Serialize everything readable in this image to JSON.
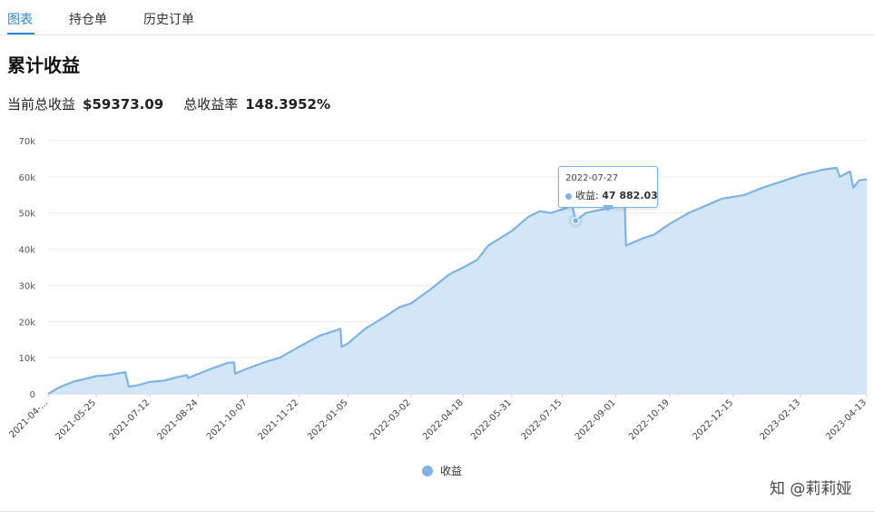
{
  "tabs": [
    {
      "label": "图表",
      "active": true
    },
    {
      "label": "持仓单",
      "active": false
    },
    {
      "label": "历史订单",
      "active": false
    }
  ],
  "title": "累计收益",
  "summary": {
    "total_profit_label": "当前总收益",
    "total_profit_value": "$59373.09",
    "total_rate_label": "总收益率",
    "total_rate_value": "148.3952%"
  },
  "tooltip": {
    "date": "2022-07-27",
    "series_label": "收益:",
    "value": "47 882.03"
  },
  "legend": {
    "label": "收益",
    "color": "#7fb2e5"
  },
  "watermark": "知 @莉莉娅",
  "chart_data": {
    "type": "area",
    "series": [
      {
        "name": "收益"
      }
    ],
    "ylim": [
      0,
      70000
    ],
    "yticks": [
      0,
      10000,
      20000,
      30000,
      40000,
      50000,
      60000,
      70000
    ],
    "ytick_labels": [
      "0",
      "10k",
      "20k",
      "30k",
      "40k",
      "50k",
      "60k",
      "70k"
    ],
    "xlim": [
      "2021-04-12",
      "2023-04-13"
    ],
    "xtick_labels": [
      "2021-04-...",
      "2021-05-25",
      "2021-07-12",
      "2021-08-24",
      "2021-10-07",
      "2021-11-22",
      "2022-01-05",
      "2022-03-02",
      "2022-04-18",
      "2022-05-31",
      "2022-07-15",
      "2022-09-01",
      "2022-10-19",
      "2022-12-15",
      "2023-02-13",
      "2023-04-13"
    ],
    "xtick_dates": [
      "2021-04-12",
      "2021-05-25",
      "2021-07-12",
      "2021-08-24",
      "2021-10-07",
      "2021-11-22",
      "2022-01-05",
      "2022-03-02",
      "2022-04-18",
      "2022-05-31",
      "2022-07-15",
      "2022-09-01",
      "2022-10-19",
      "2022-12-15",
      "2023-02-13",
      "2023-04-13"
    ],
    "grid": true,
    "legend_position": "bottom-center",
    "colors": {
      "line": "#7fb2e5",
      "fill": "#d3e6f7"
    },
    "points": [
      [
        "2021-04-12",
        0
      ],
      [
        "2021-04-22",
        1800
      ],
      [
        "2021-05-05",
        3400
      ],
      [
        "2021-05-25",
        4900
      ],
      [
        "2021-06-05",
        5200
      ],
      [
        "2021-06-20",
        6000
      ],
      [
        "2021-06-23",
        2000
      ],
      [
        "2021-06-30",
        2300
      ],
      [
        "2021-07-12",
        3300
      ],
      [
        "2021-07-25",
        3700
      ],
      [
        "2021-08-05",
        4600
      ],
      [
        "2021-08-14",
        5200
      ],
      [
        "2021-08-15",
        4400
      ],
      [
        "2021-08-24",
        5500
      ],
      [
        "2021-09-05",
        7000
      ],
      [
        "2021-09-20",
        8600
      ],
      [
        "2021-09-25",
        8700
      ],
      [
        "2021-09-26",
        5600
      ],
      [
        "2021-10-07",
        7000
      ],
      [
        "2021-10-20",
        8500
      ],
      [
        "2021-11-05",
        10000
      ],
      [
        "2021-11-22",
        13000
      ],
      [
        "2021-12-10",
        16000
      ],
      [
        "2021-12-29",
        18000
      ],
      [
        "2021-12-30",
        13000
      ],
      [
        "2022-01-05",
        14000
      ],
      [
        "2022-01-20",
        18000
      ],
      [
        "2022-02-05",
        21000
      ],
      [
        "2022-02-20",
        24000
      ],
      [
        "2022-03-02",
        25000
      ],
      [
        "2022-03-20",
        29000
      ],
      [
        "2022-04-05",
        33000
      ],
      [
        "2022-04-18",
        35000
      ],
      [
        "2022-04-30",
        37000
      ],
      [
        "2022-05-10",
        41000
      ],
      [
        "2022-05-31",
        45000
      ],
      [
        "2022-06-15",
        49000
      ],
      [
        "2022-06-25",
        50500
      ],
      [
        "2022-07-05",
        50000
      ],
      [
        "2022-07-15",
        51000
      ],
      [
        "2022-07-24",
        52000
      ],
      [
        "2022-07-27",
        47882.03
      ],
      [
        "2022-08-05",
        50000
      ],
      [
        "2022-08-20",
        51000
      ],
      [
        "2022-08-30",
        51500
      ],
      [
        "2022-09-01",
        52000
      ],
      [
        "2022-09-05",
        53500
      ],
      [
        "2022-09-09",
        52000
      ],
      [
        "2022-09-10",
        41000
      ],
      [
        "2022-09-25",
        43000
      ],
      [
        "2022-10-05",
        44000
      ],
      [
        "2022-10-19",
        47000
      ],
      [
        "2022-11-05",
        50000
      ],
      [
        "2022-11-20",
        52000
      ],
      [
        "2022-12-05",
        54000
      ],
      [
        "2022-12-15",
        54500
      ],
      [
        "2022-12-25",
        55000
      ],
      [
        "2023-01-10",
        57000
      ],
      [
        "2023-01-25",
        58500
      ],
      [
        "2023-02-13",
        60500
      ],
      [
        "2023-03-05",
        62000
      ],
      [
        "2023-03-17",
        62500
      ],
      [
        "2023-03-20",
        60000
      ],
      [
        "2023-03-29",
        61500
      ],
      [
        "2023-04-01",
        57000
      ],
      [
        "2023-04-06",
        59000
      ],
      [
        "2023-04-13",
        59373.09
      ]
    ]
  }
}
